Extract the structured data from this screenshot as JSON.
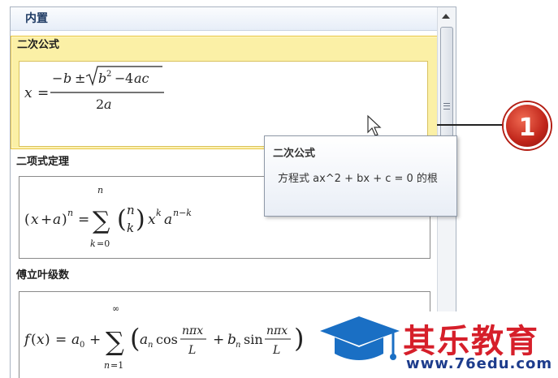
{
  "panel": {
    "header_title": "内置"
  },
  "gallery": {
    "items": [
      {
        "title": "二次公式"
      },
      {
        "title": "二项式定理"
      },
      {
        "title": "傅立叶级数"
      }
    ]
  },
  "tooltip": {
    "title": "二次公式",
    "description": "方程式 ax^2 + bx + c = 0 的根"
  },
  "callout": {
    "number": "1"
  },
  "watermark": {
    "name": "其乐教育",
    "url": "www.76edu.com"
  },
  "colors": {
    "selected_item_bg": "#fbf0a6",
    "selected_item_border": "#e7c53a",
    "callout_red": "#c0251a",
    "watermark_red": "#d61f2a",
    "watermark_blue": "#1d3c8c"
  }
}
